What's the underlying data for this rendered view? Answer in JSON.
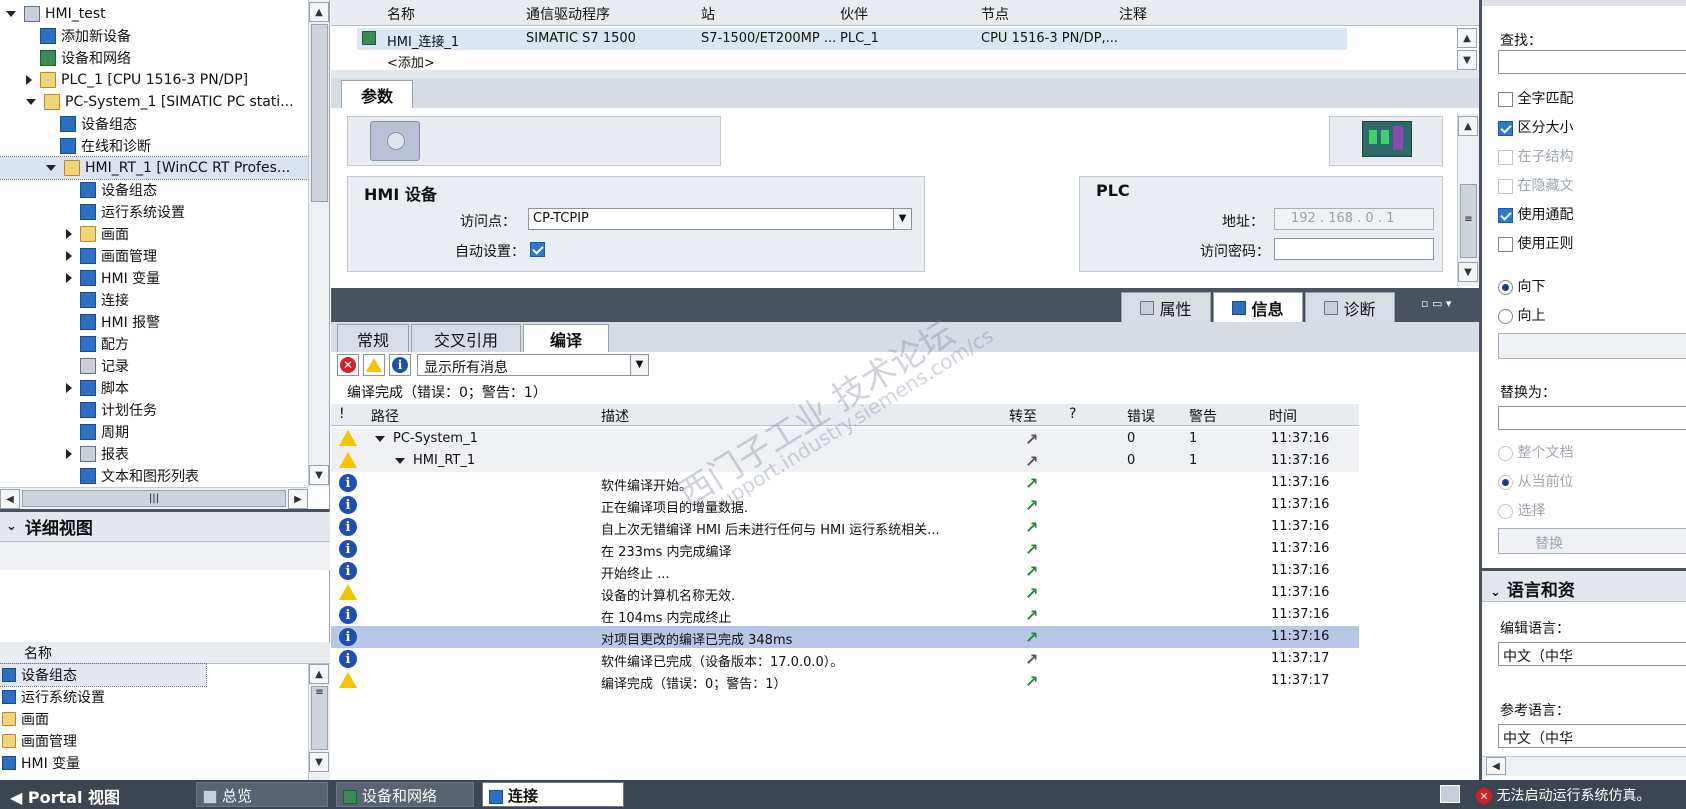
{
  "project_tree": {
    "items": [
      {
        "label": "HMI_test",
        "indent": 0,
        "arrow": "down",
        "icon": "project-icon"
      },
      {
        "label": "添加新设备",
        "indent": 1,
        "arrow": "",
        "icon": "add-device-icon"
      },
      {
        "label": "设备和网络",
        "indent": 1,
        "arrow": "",
        "icon": "network-icon"
      },
      {
        "label": "PLC_1 [CPU 1516-3 PN/DP]",
        "indent": 1,
        "arrow": "right",
        "icon": "plc-icon"
      },
      {
        "label": "PC-System_1 [SIMATIC PC stati...",
        "indent": 1,
        "arrow": "down",
        "icon": "pc-icon"
      },
      {
        "label": "设备组态",
        "indent": 2,
        "arrow": "",
        "icon": "device-config-icon"
      },
      {
        "label": "在线和诊断",
        "indent": 2,
        "arrow": "",
        "icon": "online-diag-icon"
      },
      {
        "label": "HMI_RT_1 [WinCC RT Profes...",
        "indent": 2,
        "arrow": "down",
        "icon": "hmi-rt-icon"
      },
      {
        "label": "设备组态",
        "indent": 3,
        "arrow": "",
        "icon": "device-config-icon"
      },
      {
        "label": "运行系统设置",
        "indent": 3,
        "arrow": "",
        "icon": "runtime-settings-icon"
      },
      {
        "label": "画面",
        "indent": 3,
        "arrow": "right",
        "icon": "folder-icon"
      },
      {
        "label": "画面管理",
        "indent": 3,
        "arrow": "right",
        "icon": "screen-mgmt-icon"
      },
      {
        "label": "HMI 变量",
        "indent": 3,
        "arrow": "right",
        "icon": "hmi-tags-icon"
      },
      {
        "label": "连接",
        "indent": 3,
        "arrow": "",
        "icon": "connection-icon"
      },
      {
        "label": "HMI 报警",
        "indent": 3,
        "arrow": "",
        "icon": "alarm-icon"
      },
      {
        "label": "配方",
        "indent": 3,
        "arrow": "",
        "icon": "recipe-icon"
      },
      {
        "label": "记录",
        "indent": 3,
        "arrow": "",
        "icon": "log-icon"
      },
      {
        "label": "脚本",
        "indent": 3,
        "arrow": "right",
        "icon": "script-icon"
      },
      {
        "label": "计划任务",
        "indent": 3,
        "arrow": "",
        "icon": "scheduler-icon"
      },
      {
        "label": "周期",
        "indent": 3,
        "arrow": "",
        "icon": "cycle-icon"
      },
      {
        "label": "报表",
        "indent": 3,
        "arrow": "right",
        "icon": "report-icon"
      },
      {
        "label": "文本和图形列表",
        "indent": 3,
        "arrow": "",
        "icon": "text-graphic-list-icon"
      }
    ]
  },
  "detail_view": {
    "title": "详细视图",
    "column_name": "名称",
    "items": [
      "设备组态",
      "运行系统设置",
      "画面",
      "画面管理",
      "HMI 变量"
    ]
  },
  "connections_table": {
    "headers": [
      "名称",
      "通信驱动程序",
      "站",
      "伙伴",
      "节点",
      "注释"
    ],
    "row": [
      "HMI_连接_1",
      "SIMATIC S7 1500",
      "S7-1500/ET200MP ...",
      "PLC_1",
      "CPU 1516-3 PN/DP,...",
      ""
    ],
    "add_row": "<添加>"
  },
  "params": {
    "tab": "参数",
    "hmi_title": "HMI 设备",
    "access_point_label": "访问点：",
    "access_point_value": "CP-TCPIP",
    "auto_setting_label": "自动设置：",
    "plc_title": "PLC",
    "address_label": "地址：",
    "address_value": "192 . 168 . 0 . 1",
    "password_label": "访问密码："
  },
  "inspector_tabs": {
    "properties": "属性",
    "info": "信息",
    "diagnostics": "诊断"
  },
  "info_tabs": {
    "general": "常规",
    "crossref": "交叉引用",
    "compile": "编译"
  },
  "filter": {
    "value": "显示所有消息"
  },
  "compile_summary": "编译完成（错误：0；警告：1）",
  "msg_headers": {
    "bang": "!",
    "path": "路径",
    "desc": "描述",
    "goto": "转至",
    "q": "?",
    "errors": "错误",
    "warnings": "警告",
    "time": "时间"
  },
  "messages": [
    {
      "type": "warn",
      "path": "PC-System_1",
      "level": 0,
      "desc": "",
      "errors": "0",
      "warnings": "1",
      "time": "11:37:16"
    },
    {
      "type": "warn",
      "path": "HMI_RT_1",
      "level": 1,
      "desc": "",
      "errors": "0",
      "warnings": "1",
      "time": "11:37:16"
    },
    {
      "type": "info",
      "path": "",
      "level": 2,
      "desc": "软件编译开始。",
      "errors": "",
      "warnings": "",
      "time": "11:37:16"
    },
    {
      "type": "info",
      "path": "",
      "level": 2,
      "desc": "正在编译项目的增量数据.",
      "errors": "",
      "warnings": "",
      "time": "11:37:16"
    },
    {
      "type": "info",
      "path": "",
      "level": 2,
      "desc": "自上次无错编译 HMI 后未进行任何与 HMI 运行系统相关...",
      "errors": "",
      "warnings": "",
      "time": "11:37:16"
    },
    {
      "type": "info",
      "path": "",
      "level": 2,
      "desc": "在 233ms 内完成编译",
      "errors": "",
      "warnings": "",
      "time": "11:37:16"
    },
    {
      "type": "info",
      "path": "",
      "level": 2,
      "desc": "开始终止 ...",
      "errors": "",
      "warnings": "",
      "time": "11:37:16"
    },
    {
      "type": "warn",
      "path": "",
      "level": 2,
      "desc": "设备的计算机名称无效.",
      "errors": "",
      "warnings": "",
      "time": "11:37:16"
    },
    {
      "type": "info",
      "path": "",
      "level": 2,
      "desc": "在 104ms 内完成终止",
      "errors": "",
      "warnings": "",
      "time": "11:37:16"
    },
    {
      "type": "info",
      "path": "",
      "level": 2,
      "desc": "对项目更改的编译已完成 348ms",
      "errors": "",
      "warnings": "",
      "time": "11:37:16",
      "selected": true
    },
    {
      "type": "info",
      "path": "",
      "level": 2,
      "desc": "软件编译已完成（设备版本：17.0.0.0）。",
      "errors": "",
      "warnings": "",
      "time": "11:37:17"
    },
    {
      "type": "warn",
      "path": "",
      "level": 2,
      "desc": "编译完成（错误：0；警告：1）",
      "errors": "",
      "warnings": "",
      "time": "11:37:17"
    }
  ],
  "find_replace": {
    "find_label": "查找：",
    "whole_word": "全字匹配",
    "match_case": "区分大小",
    "in_substructures": "在子结构",
    "in_hidden": "在隐藏文",
    "use_wildcards": "使用通配",
    "use_regex": "使用正则",
    "down": "向下",
    "up": "向上",
    "replace_label": "替换为：",
    "whole_document": "整个文档",
    "from_current": "从当前位",
    "selection": "选择",
    "replace_btn": "替换",
    "lang_title": "语言和资",
    "edit_lang_label": "编辑语言：",
    "edit_lang_value": "中文（中华",
    "ref_lang_label": "参考语言：",
    "ref_lang_value": "中文（中华"
  },
  "statusbar": {
    "portal": "Portal 视图",
    "overview": "总览",
    "devices": "设备和网络",
    "connection": "连接",
    "error_msg": "无法启动运行系统仿真。"
  },
  "watermark": {
    "line1": "西门子工业 技术论坛",
    "line2": "support.industry.siemens.com/cs"
  },
  "colors": {
    "accent": "#2a7ad3",
    "selected_row": "#b7c8e6",
    "panel_bg": "#dfe3e9",
    "dark_band": "#4a5260"
  }
}
